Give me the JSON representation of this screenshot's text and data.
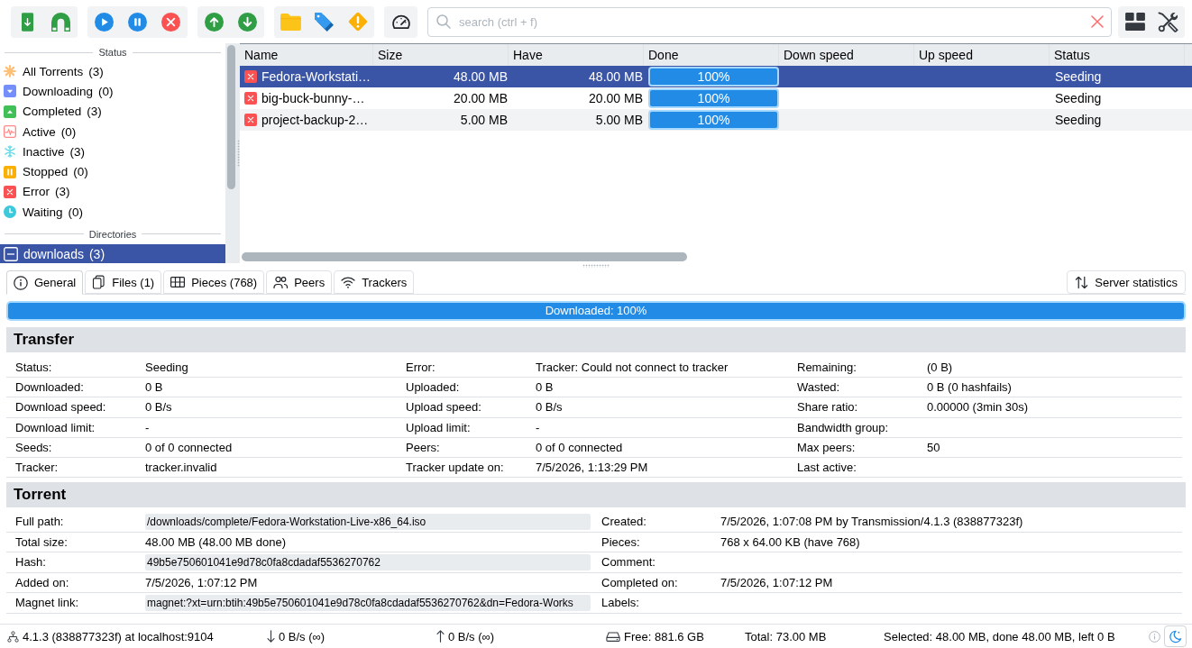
{
  "toolbar": {
    "groups": [
      {
        "buttons": [
          {
            "kind": "add_file"
          },
          {
            "kind": "magnet"
          }
        ]
      },
      {
        "buttons": [
          {
            "kind": "start"
          },
          {
            "kind": "pause"
          },
          {
            "kind": "remove"
          }
        ]
      },
      {
        "buttons": [
          {
            "kind": "queue_up"
          },
          {
            "kind": "queue_down"
          }
        ]
      },
      {
        "buttons": [
          {
            "kind": "move"
          },
          {
            "kind": "labels"
          },
          {
            "kind": "priority"
          }
        ]
      },
      {
        "buttons": [
          {
            "kind": "speed"
          }
        ]
      }
    ],
    "search": {
      "placeholder": "search (ctrl + f)"
    },
    "end_buttons": [
      {
        "kind": "layout"
      },
      {
        "kind": "settings"
      }
    ]
  },
  "sidebar": {
    "status_heading": "Status",
    "status_items": [
      {
        "kind": "all",
        "label": "All Torrents",
        "count": "(3)",
        "selected": false
      },
      {
        "kind": "downloading",
        "label": "Downloading",
        "count": "(0)",
        "selected": false
      },
      {
        "kind": "completed",
        "label": "Completed",
        "count": "(3)",
        "selected": false
      },
      {
        "kind": "active",
        "label": "Active",
        "count": "(0)",
        "selected": false
      },
      {
        "kind": "inactive",
        "label": "Inactive",
        "count": "(3)",
        "selected": false
      },
      {
        "kind": "stopped",
        "label": "Stopped",
        "count": "(0)",
        "selected": false
      },
      {
        "kind": "error",
        "label": "Error",
        "count": "(3)",
        "selected": false
      },
      {
        "kind": "waiting",
        "label": "Waiting",
        "count": "(0)",
        "selected": false
      }
    ],
    "directories_heading": "Directories",
    "directories": [
      {
        "label": "downloads",
        "count": "(3)",
        "selected": true,
        "expanded": true
      }
    ]
  },
  "table": {
    "columns": [
      "Name",
      "Size",
      "Have",
      "Done",
      "Down speed",
      "Up speed",
      "Status"
    ],
    "rows": [
      {
        "selected": true,
        "error": true,
        "name": "Fedora-Workstati…",
        "size": "48.00 MB",
        "have": "48.00 MB",
        "done": {
          "level": 1,
          "reading": "100%"
        },
        "status": "Seeding"
      },
      {
        "selected": false,
        "error": true,
        "name": "big-buck-bunny-…",
        "size": "20.00 MB",
        "have": "20.00 MB",
        "done": {
          "level": 1,
          "reading": "100%"
        },
        "status": "Seeding"
      },
      {
        "selected": false,
        "error": true,
        "name": "project-backup-2…",
        "size": "5.00 MB",
        "have": "5.00 MB",
        "done": {
          "level": 1,
          "reading": "100%"
        },
        "status": "Seeding"
      }
    ]
  },
  "details": {
    "tabs": [
      {
        "kind": "info",
        "label": "General",
        "selected": true
      },
      {
        "kind": "files",
        "label": "Files (1)",
        "selected": false
      },
      {
        "kind": "pieces",
        "label": "Pieces (768)",
        "selected": false
      },
      {
        "kind": "peers",
        "label": "Peers",
        "selected": false
      },
      {
        "kind": "trackers",
        "label": "Trackers",
        "selected": false
      }
    ],
    "server_stats_button": "Server statistics",
    "progress": {
      "label": "Downloaded: 100%",
      "level": 1
    },
    "sections": [
      {
        "title": "Transfer",
        "rows": [
          [
            {
              "label": "Status:",
              "value": "Seeding"
            },
            {
              "label": "Error:",
              "value": "Tracker: Could not connect to tracker"
            },
            {
              "label": "Remaining:",
              "value": "(0 B)"
            }
          ],
          [
            {
              "label": "Downloaded:",
              "value": "0 B"
            },
            {
              "label": "Uploaded:",
              "value": "0 B"
            },
            {
              "label": "Wasted:",
              "value": "0 B (0 hashfails)"
            }
          ],
          [
            {
              "label": "Download speed:",
              "value": "0 B/s"
            },
            {
              "label": "Upload speed:",
              "value": "0 B/s"
            },
            {
              "label": "Share ratio:",
              "value": "0.00000 (3min 30s)"
            }
          ],
          [
            {
              "label": "Download limit:",
              "value": "-"
            },
            {
              "label": "Upload limit:",
              "value": "-"
            },
            {
              "label": "Bandwidth group:"
            }
          ],
          [
            {
              "label": "Seeds:",
              "value": "0 of 0 connected"
            },
            {
              "label": "Peers:",
              "value": "0 of 0 connected"
            },
            {
              "label": "Max peers:",
              "value": "50"
            }
          ],
          [
            {
              "label": "Tracker:",
              "value": "tracker.invalid"
            },
            {
              "label": "Tracker update on:",
              "value": "7/5/2026, 1:13:29 PM"
            },
            {
              "label": "Last active:"
            }
          ]
        ]
      },
      {
        "title": "Torrent",
        "rows": [
          [
            {
              "kind": "box",
              "label": "Full path:",
              "value": "/downloads/complete/Fedora-Workstation-Live-x86_64.iso"
            },
            {
              "kind": "text",
              "label": "Created:",
              "value": "7/5/2026, 1:07:08 PM by Transmission/4.1.3 (838877323f)"
            }
          ],
          [
            {
              "kind": "text",
              "label": "Total size:",
              "value": "48.00 MB (48.00 MB done)"
            },
            {
              "kind": "text",
              "label": "Pieces:",
              "value": "768 x 64.00 KB (have 768)"
            }
          ],
          [
            {
              "kind": "box",
              "label": "Hash:",
              "value": "49b5e750601041e9d78c0fa8cdadaf5536270762"
            },
            {
              "kind": "text",
              "label": "Comment:"
            }
          ],
          [
            {
              "kind": "text",
              "label": "Added on:",
              "value": "7/5/2026, 1:07:12 PM"
            },
            {
              "kind": "text",
              "label": "Completed on:",
              "value": "7/5/2026, 1:07:12 PM"
            }
          ],
          [
            {
              "kind": "box",
              "label": "Magnet link:",
              "value": "magnet:?xt=urn:btih:49b5e750601041e9d78c0fa8cdadaf5536270762&dn=Fedora-Works"
            },
            {
              "kind": "text",
              "label": "Labels:"
            }
          ]
        ]
      }
    ]
  },
  "status_bar": {
    "items": [
      {
        "kind": "connection",
        "text": "4.1.3 (838877323f) at localhost:9104"
      },
      {
        "kind": "download",
        "text": "0 B/s (∞)"
      },
      {
        "kind": "upload",
        "text": "0 B/s (∞)"
      },
      {
        "kind": "free_space",
        "text": "Free: 881.6 GB"
      },
      {
        "kind": "text",
        "text": "Total: 73.00 MB"
      },
      {
        "kind": "text",
        "text": "Selected: 48.00 MB, done 48.00 MB, left 0 B"
      }
    ],
    "buttons": [
      {
        "kind": "info"
      },
      {
        "kind": "theme"
      }
    ]
  }
}
